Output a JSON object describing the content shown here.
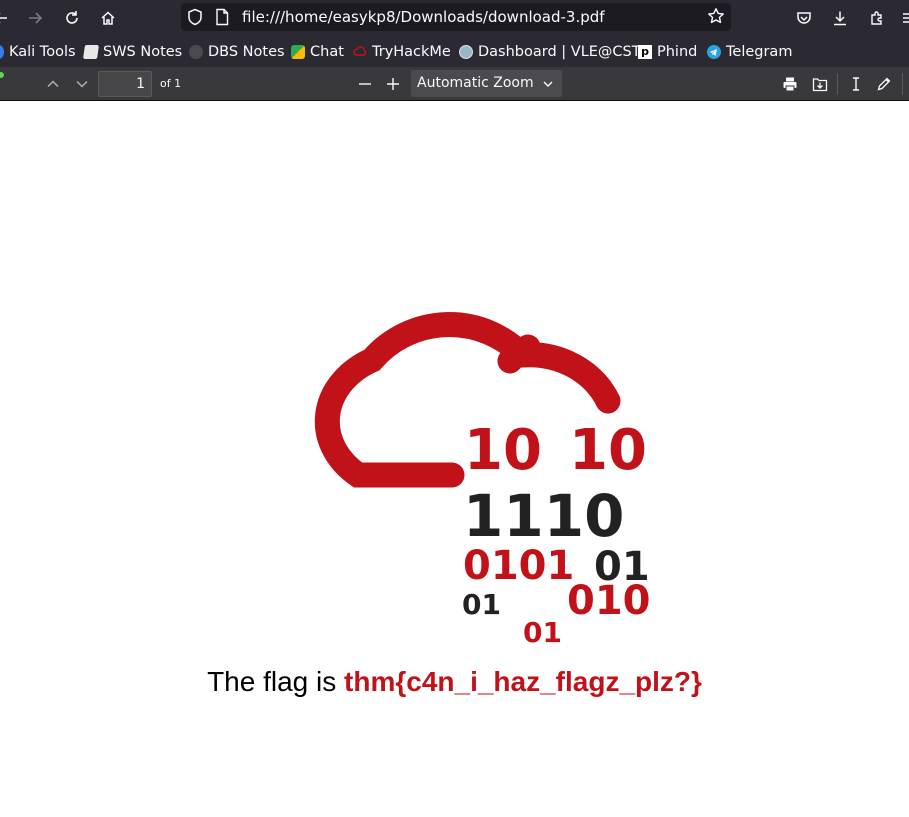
{
  "browser": {
    "url": "file:///home/easykp8/Downloads/download-3.pdf"
  },
  "bookmarks": [
    {
      "label": "Kali Tools",
      "icon": "kali-icon"
    },
    {
      "label": "SWS Notes",
      "icon": "notebook-icon"
    },
    {
      "label": "DBS Notes",
      "icon": "notebook-dark-icon"
    },
    {
      "label": "Chat",
      "icon": "chat-icon"
    },
    {
      "label": "TryHackMe",
      "icon": "tryhackme-icon"
    },
    {
      "label": "Dashboard | VLE@CST",
      "icon": "moodle-icon"
    },
    {
      "label": "Phind",
      "icon": "phind-icon"
    },
    {
      "label": "Telegram",
      "icon": "telegram-icon"
    }
  ],
  "pdf_toolbar": {
    "page_number": "1",
    "page_count": "of 1",
    "zoom": "Automatic Zoom"
  },
  "document": {
    "binary": {
      "row1a": "10",
      "row1b": "10",
      "row2": "1110",
      "row3a": "0101",
      "row3b": "01",
      "row4a": "01",
      "row4b": "010",
      "row5": "01"
    },
    "flag_prefix": "The flag is ",
    "flag_value": "thm{c4n_i_haz_flagz_plz?}"
  },
  "colors": {
    "brand_red": "#c1121a",
    "dark_text": "#222222",
    "toolbar_bg": "#2b2a33",
    "pdf_toolbar_bg": "#38383d"
  }
}
